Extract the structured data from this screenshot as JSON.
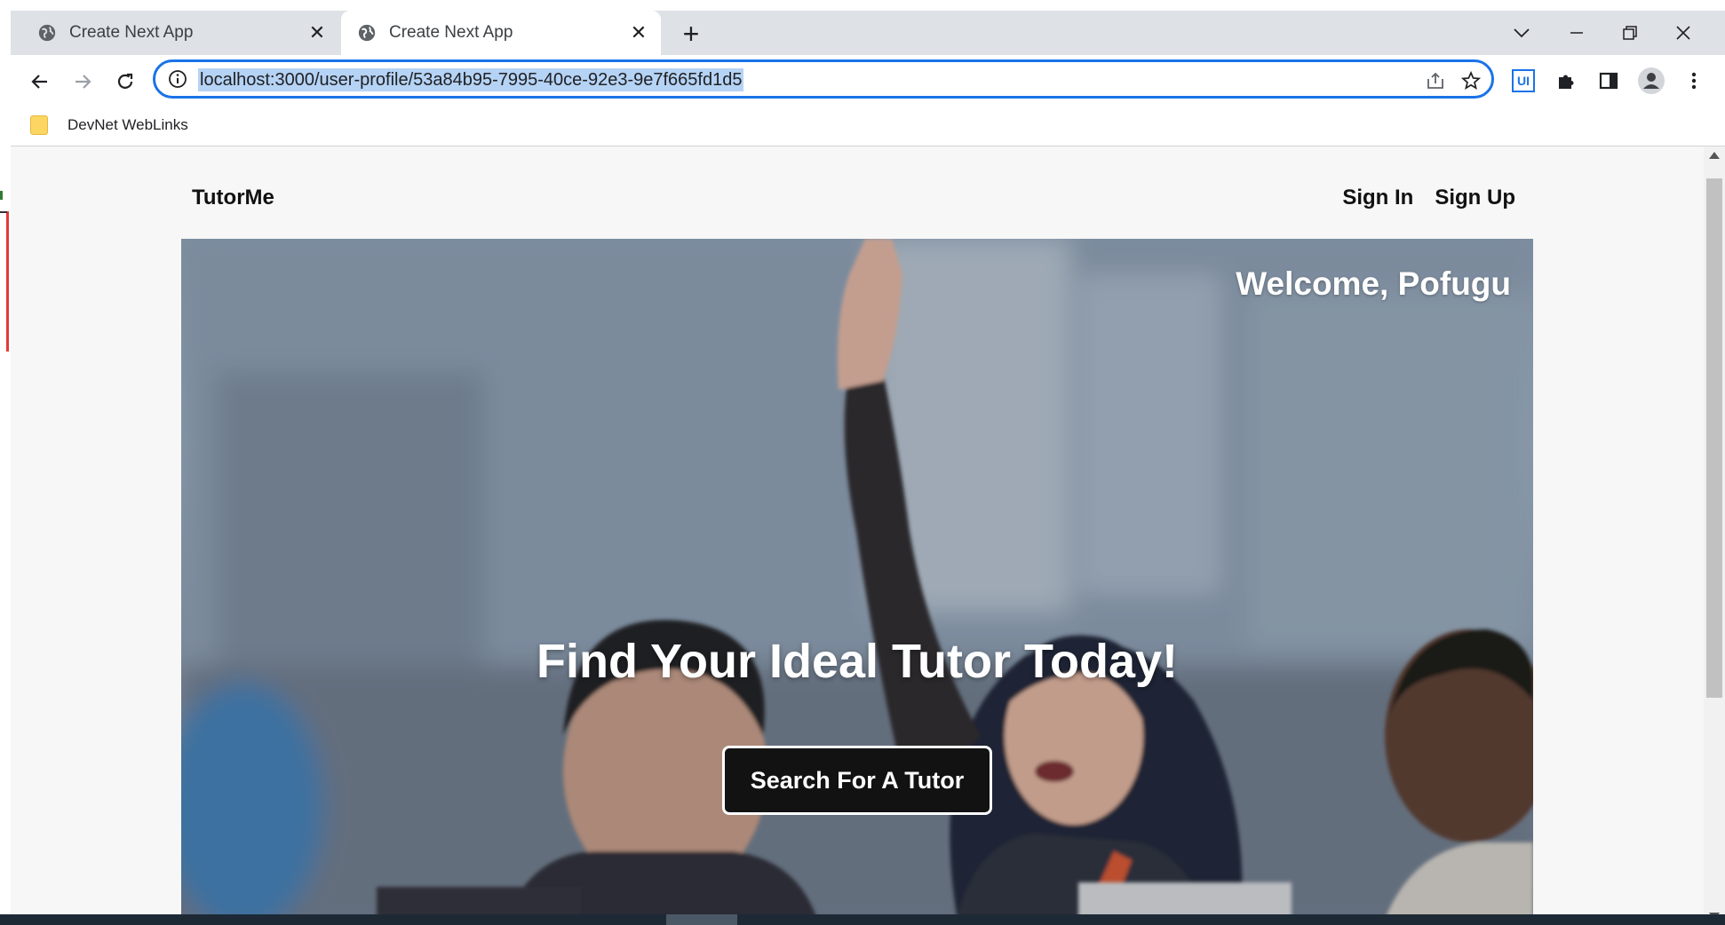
{
  "browser": {
    "tabs": [
      {
        "title": "Create Next App",
        "active": false
      },
      {
        "title": "Create Next App",
        "active": true
      }
    ],
    "address_bar": {
      "url": "localhost:3000/user-profile/53a84b95-7995-40ce-92e3-9e7f665fd1d5"
    },
    "extension_label": "UI",
    "bookmarks": [
      {
        "label": "DevNet WebLinks",
        "icon": "folder-icon"
      }
    ]
  },
  "page": {
    "brand": "TutorMe",
    "nav": {
      "sign_in": "Sign In",
      "sign_up": "Sign Up"
    },
    "hero": {
      "welcome": "Welcome, Pofugu",
      "headline": "Find Your Ideal Tutor Today!",
      "cta": "Search For A Tutor"
    }
  },
  "colors": {
    "accent": "#1a73e8",
    "cta_bg": "#121212",
    "page_bg": "#f7f7f7"
  }
}
